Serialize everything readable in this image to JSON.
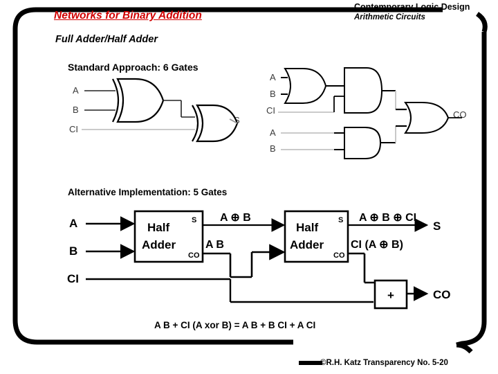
{
  "slide": {
    "title": "Networks for Binary Addition",
    "title_color": "#d00000",
    "header_line1": "Contemporary Logic Design",
    "header_line2": "Arithmetic Circuits",
    "subtitle": "Full Adder/Half Adder",
    "standard_label": "Standard Approach:  6 Gates",
    "alternative_label": "Alternative Implementation:  5 Gates",
    "equation": "A B + CI (A xor B) = A B + B CI + A CI",
    "footer": "©R.H. Katz   Transparency No. 5-20"
  },
  "standard_circuit": {
    "sum_block": {
      "inputs": [
        "A",
        "B",
        "CI"
      ],
      "output": "S",
      "gates": [
        "xor-gate",
        "xor-gate"
      ]
    },
    "carry_block": {
      "inputs": [
        "A",
        "B",
        "CI",
        "A",
        "B"
      ],
      "output": "CO",
      "gates": [
        "or-gate",
        "and-gate",
        "and-gate",
        "or-gate"
      ]
    }
  },
  "alternative_circuit": {
    "inputs": [
      "A",
      "B",
      "CI"
    ],
    "blocks": [
      {
        "line1": "Half",
        "line2": "Adder",
        "port_s": "S",
        "port_co": "CO"
      },
      {
        "line1": "Half",
        "line2": "Adder",
        "port_s": "S",
        "port_co": "CO"
      }
    ],
    "adder_block": {
      "label": "+"
    },
    "wire_labels": {
      "ha1_sum": "A ⊕ B",
      "ha1_carry": "A B",
      "ha2_sum": "A ⊕ B ⊕ CI",
      "ha2_carry": "CI (A ⊕ B)"
    },
    "outputs": [
      "S",
      "CO"
    ]
  }
}
